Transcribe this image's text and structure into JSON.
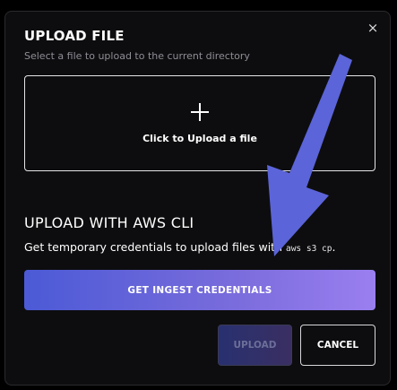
{
  "modal": {
    "close_glyph": "×",
    "title": "UPLOAD FILE",
    "subtitle": "Select a file to upload to the current directory"
  },
  "dropzone": {
    "icon": "plus-icon",
    "label": "Click to Upload a file"
  },
  "cli": {
    "title": "UPLOAD WITH AWS CLI",
    "description": "Get temporary credentials to upload files with ",
    "command": "aws s3 cp",
    "suffix": "."
  },
  "buttons": {
    "ingest_label": "GET INGEST CREDENTIALS",
    "upload_label": "UPLOAD",
    "cancel_label": "CANCEL"
  },
  "annotation": {
    "icon": "arrow-annotation",
    "color": "#5b64d8"
  },
  "colors": {
    "background": "#0d0d0f",
    "accent_start": "#4b5ad6",
    "accent_end": "#9a7ff0"
  }
}
